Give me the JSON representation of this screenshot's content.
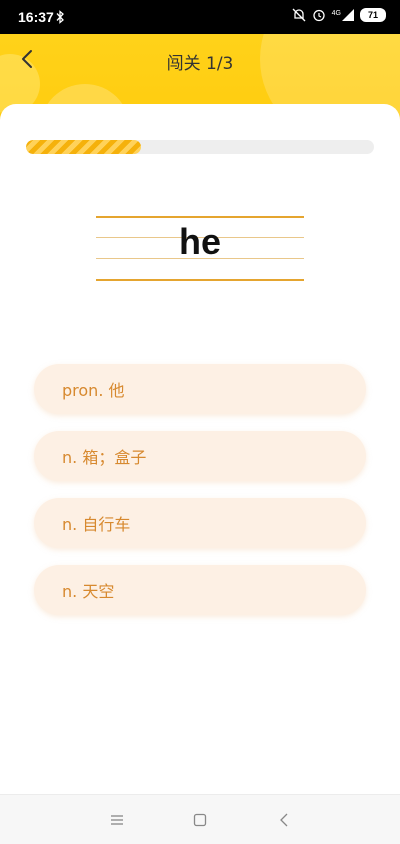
{
  "status_bar": {
    "time": "16:37",
    "network": "4G",
    "battery": "71"
  },
  "header": {
    "title": "闯关 1/3"
  },
  "quiz": {
    "progress": 0.33,
    "word": "he",
    "options": [
      {
        "label": "pron. 他"
      },
      {
        "label": "n. 箱；盒子"
      },
      {
        "label": "n. 自行车"
      },
      {
        "label": "n. 天空"
      }
    ]
  },
  "icons": {
    "back": "chevron-left-icon",
    "nav_menu": "menu-icon",
    "nav_home": "square-home-icon",
    "nav_back": "triangle-back-icon"
  },
  "colors": {
    "accent": "#ffcb0c",
    "progress": "#f5b10b",
    "option_bg": "#fdf0e4",
    "option_text": "#d7892f"
  }
}
